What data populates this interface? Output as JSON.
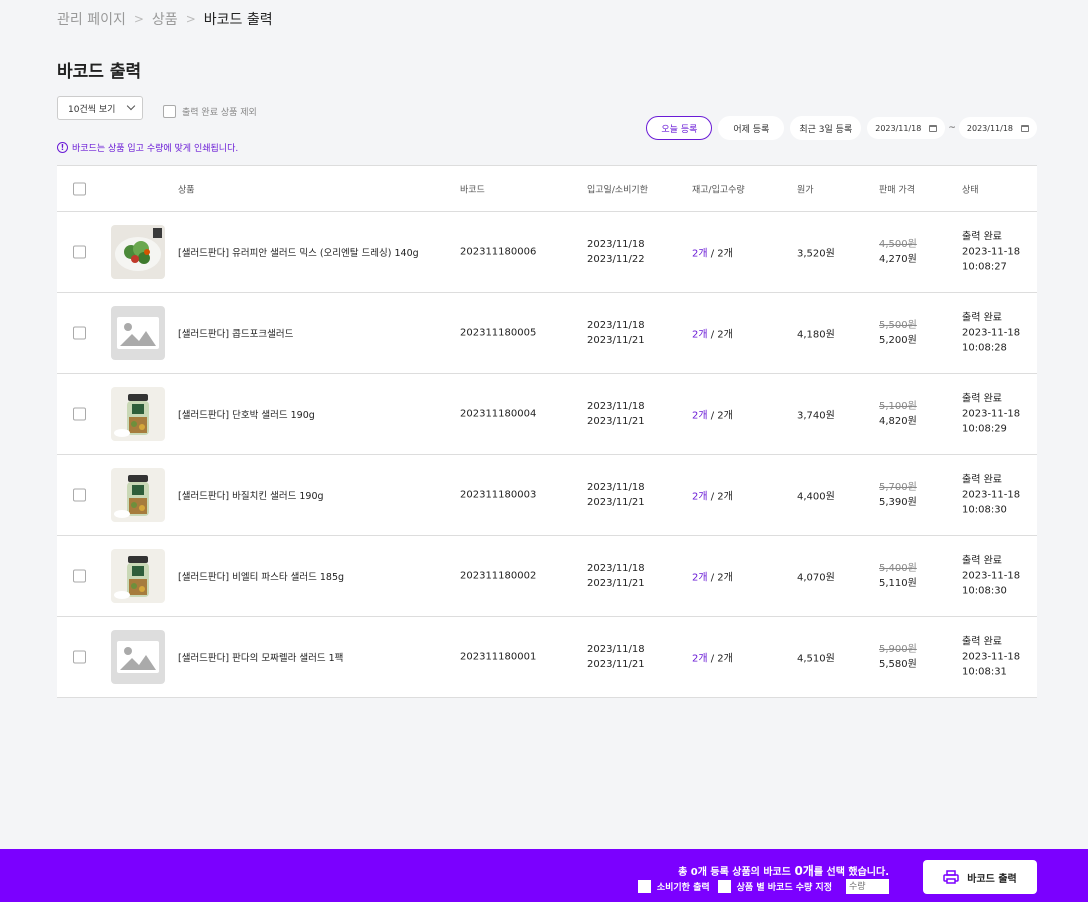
{
  "breadcrumb": [
    "관리 페이지",
    "상품",
    "바코드 출력"
  ],
  "page_title": "바코드 출력",
  "per_page": "10건씩 보기",
  "exclude_label": "출력 완료 상품 제외",
  "notice": "바코드는 상품 입고 수량에 맞게 인쇄됩니다.",
  "filters": {
    "today": "오늘 등록",
    "yesterday": "어제 등록",
    "last3": "최근 3일 등록",
    "date_from": "2023/11/18",
    "date_to": "2023/11/18",
    "tilde": "~"
  },
  "columns": [
    "상품",
    "바코드",
    "입고일/소비기한",
    "재고/입고수량",
    "원가",
    "판매 가격",
    "상태"
  ],
  "rows": [
    {
      "name": "[샐러드판다] 유러피안 샐러드 믹스 (오리엔탈 드레싱) 140g",
      "barcode": "202311180006",
      "in_date": "2023/11/18",
      "exp_date": "2023/11/22",
      "stock": "2개",
      "incoming": "/ 2개",
      "cost": "3,520원",
      "old_price": "4,500원",
      "price": "4,270원",
      "status": "출력 완료",
      "s_date": "2023-11-18",
      "s_time": "10:08:27",
      "img": "salad-photo"
    },
    {
      "name": "[샐러드판다] 콥드포크샐러드",
      "barcode": "202311180005",
      "in_date": "2023/11/18",
      "exp_date": "2023/11/21",
      "stock": "2개",
      "incoming": "/ 2개",
      "cost": "4,180원",
      "old_price": "5,500원",
      "price": "5,200원",
      "status": "출력 완료",
      "s_date": "2023-11-18",
      "s_time": "10:08:28",
      "img": "placeholder"
    },
    {
      "name": "[샐러드판다] 단호박 샐러드 190g",
      "barcode": "202311180004",
      "in_date": "2023/11/18",
      "exp_date": "2023/11/21",
      "stock": "2개",
      "incoming": "/ 2개",
      "cost": "3,740원",
      "old_price": "5,100원",
      "price": "4,820원",
      "status": "출력 완료",
      "s_date": "2023-11-18",
      "s_time": "10:08:29",
      "img": "jar-photo"
    },
    {
      "name": "[샐러드판다] 바질치킨 샐러드 190g",
      "barcode": "202311180003",
      "in_date": "2023/11/18",
      "exp_date": "2023/11/21",
      "stock": "2개",
      "incoming": "/ 2개",
      "cost": "4,400원",
      "old_price": "5,700원",
      "price": "5,390원",
      "status": "출력 완료",
      "s_date": "2023-11-18",
      "s_time": "10:08:30",
      "img": "jar-photo"
    },
    {
      "name": "[샐러드판다] 비엘티 파스타 샐러드 185g",
      "barcode": "202311180002",
      "in_date": "2023/11/18",
      "exp_date": "2023/11/21",
      "stock": "2개",
      "incoming": "/ 2개",
      "cost": "4,070원",
      "old_price": "5,400원",
      "price": "5,110원",
      "status": "출력 완료",
      "s_date": "2023-11-18",
      "s_time": "10:08:30",
      "img": "jar-photo"
    },
    {
      "name": "[샐러드판다] 판다의 모짜렐라 샐러드 1팩",
      "barcode": "202311180001",
      "in_date": "2023/11/18",
      "exp_date": "2023/11/21",
      "stock": "2개",
      "incoming": "/ 2개",
      "cost": "4,510원",
      "old_price": "5,900원",
      "price": "5,580원",
      "status": "출력 완료",
      "s_date": "2023-11-18",
      "s_time": "10:08:31",
      "img": "placeholder"
    }
  ],
  "bottom": {
    "summary_pre": "총 0개 등록 상품의 바코드 ",
    "summary_count": "0개",
    "summary_post": "를 선택 했습니다.",
    "opt_expiry": "소비기한 출력",
    "opt_qty": "상품 별 바코드 수량 지정",
    "qty_placeholder": "수량",
    "print_label": "바코드 출력"
  },
  "colors": {
    "accent": "#7b00ff",
    "link": "#6a1bd6"
  }
}
